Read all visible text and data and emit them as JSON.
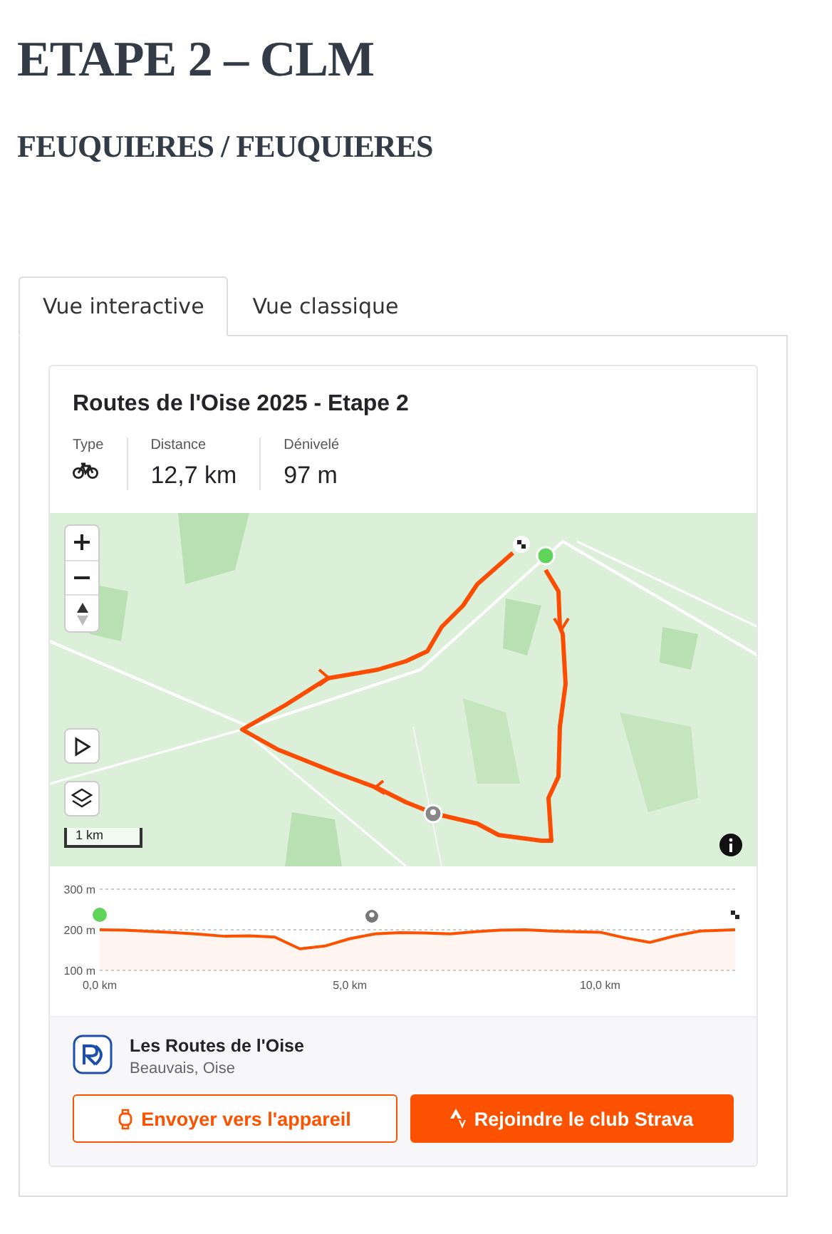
{
  "page": {
    "title": "ETAPE 2 – CLM",
    "subtitle": "FEUQUIERES / FEUQUIERES"
  },
  "tabs": [
    {
      "label": "Vue interactive",
      "selected": true
    },
    {
      "label": "Vue classique",
      "selected": false
    }
  ],
  "route_card": {
    "title": "Routes de l'Oise 2025 - Etape 2",
    "stats": [
      {
        "label": "Type",
        "kind": "icon"
      },
      {
        "label": "Distance",
        "value": "12,7 km",
        "kind": "text"
      },
      {
        "label": "Dénivelé",
        "value": "97 m",
        "kind": "text"
      }
    ],
    "map": {
      "kind": "picture",
      "scale": "1 km"
    },
    "elevation": {
      "chart_data": {
        "type": "area",
        "xlim": [
          0,
          12.7
        ],
        "ylim": [
          100,
          300
        ],
        "x": [
          0,
          0.5,
          1,
          1.5,
          2,
          2.5,
          3,
          3.5,
          4,
          4.5,
          5,
          5.5,
          6,
          6.5,
          7,
          7.5,
          8,
          8.5,
          9,
          9.5,
          10,
          10.5,
          11,
          11.5,
          12,
          12.7
        ],
        "series": [
          {
            "color": "#fc5200",
            "values": [
              200,
              199,
              196,
              193,
              189,
              184,
              185,
              182,
              153,
              160,
              178,
              190,
              193,
              192,
              190,
              195,
              199,
              200,
              197,
              195,
              194,
              180,
              169,
              185,
              197,
              200
            ]
          }
        ],
        "xticks": [
          {
            "value": 0,
            "label": "0,0 km"
          },
          {
            "value": 5,
            "label": "5,0 km"
          },
          {
            "value": 10,
            "label": "10,0 km"
          }
        ],
        "yticks": [
          {
            "value": 100,
            "label": "100 m"
          },
          {
            "value": 200,
            "label": "200 m"
          },
          {
            "value": 300,
            "label": "300 m"
          }
        ]
      }
    },
    "club": {
      "name": "Les Routes de l'Oise",
      "location": "Beauvais, Oise"
    },
    "buttons": [
      {
        "label": "Envoyer vers l'appareil",
        "kind": "outline"
      },
      {
        "label": "Rejoindre le club Strava",
        "kind": "primary"
      }
    ]
  }
}
